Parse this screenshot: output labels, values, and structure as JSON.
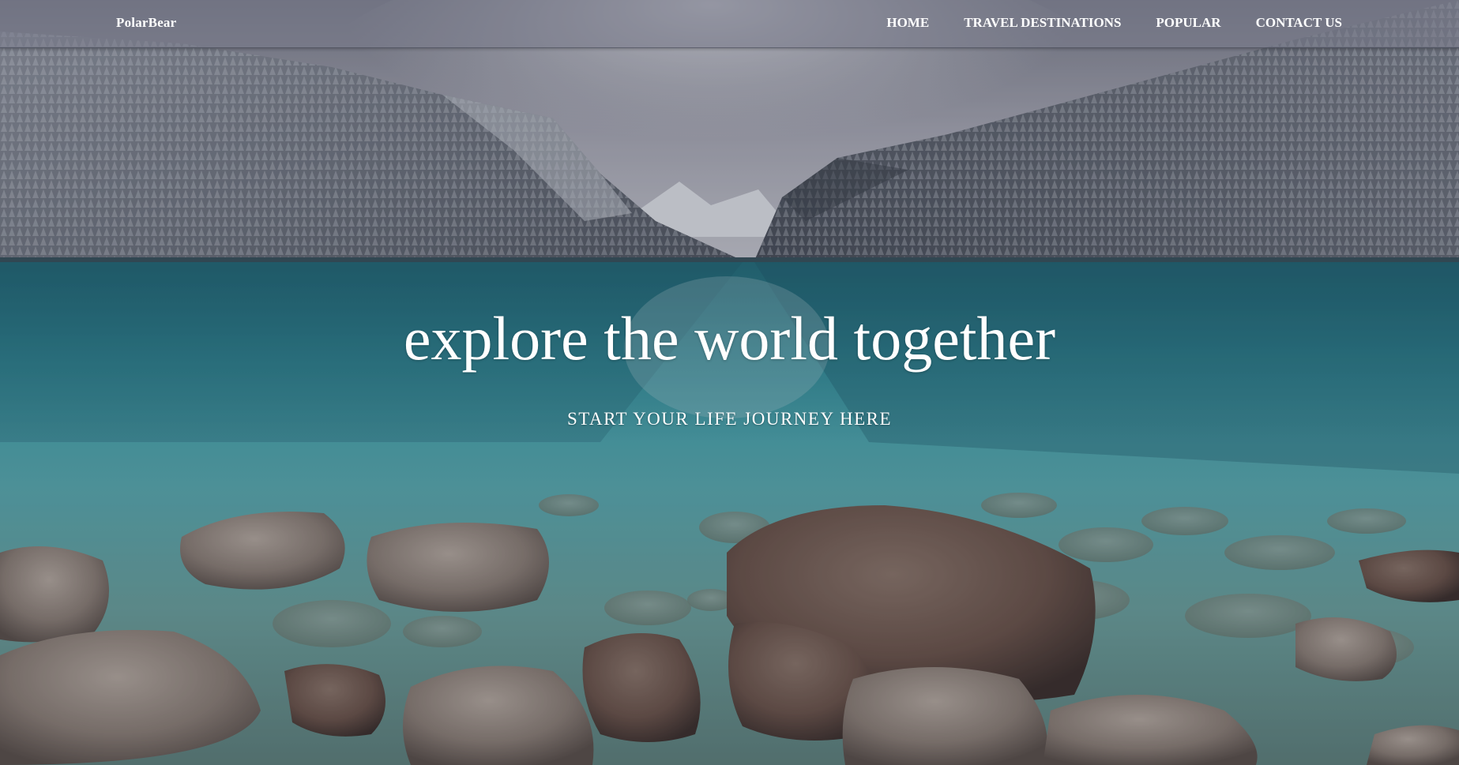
{
  "navbar": {
    "brand": "PolarBear",
    "links": [
      "HOME",
      "TRAVEL DESTINATIONS",
      "POPULAR",
      "CONTACT US"
    ]
  },
  "hero": {
    "headline": "explore the world together",
    "subheadline": "START YOUR LIFE JOURNEY HERE"
  },
  "colors": {
    "nav_text": "#ffffff",
    "lake_teal": "#3fa3ad",
    "forest": "#6d727c"
  },
  "icons": []
}
